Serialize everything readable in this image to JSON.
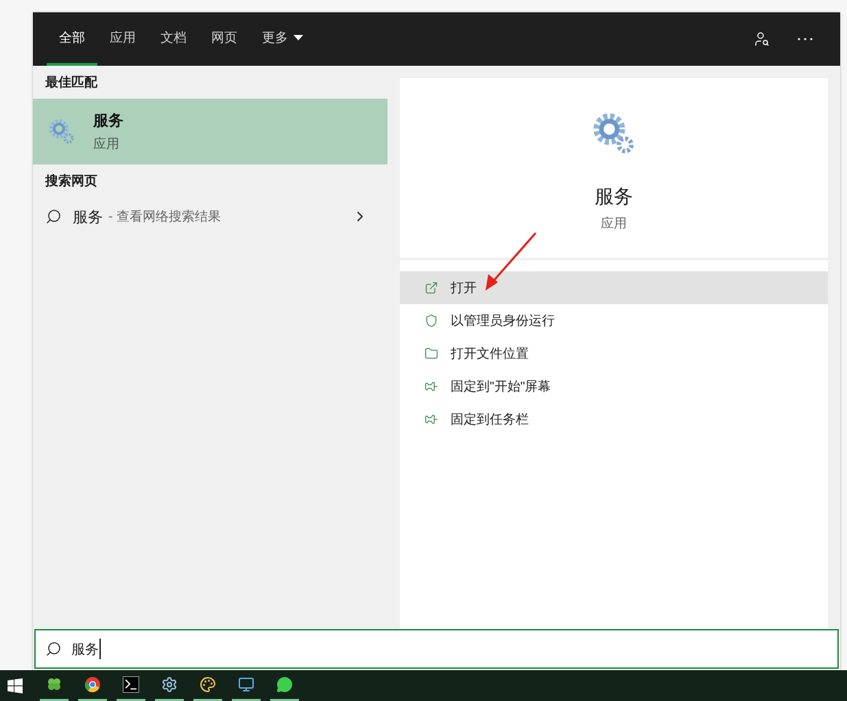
{
  "tabs": [
    {
      "label": "全部",
      "selected": true
    },
    {
      "label": "应用",
      "selected": false
    },
    {
      "label": "文档",
      "selected": false
    },
    {
      "label": "网页",
      "selected": false
    },
    {
      "label": "更多",
      "selected": false,
      "dropdown": true
    }
  ],
  "best_match": {
    "heading": "最佳匹配",
    "title": "服务",
    "subtitle": "应用",
    "selected": true
  },
  "web_search": {
    "heading": "搜索网页",
    "query": "服务",
    "suffix": "- 查看网络搜索结果"
  },
  "detail": {
    "title": "服务",
    "subtitle": "应用"
  },
  "actions": [
    {
      "kind": "open",
      "label": "打开",
      "highlighted": true
    },
    {
      "kind": "admin",
      "label": "以管理员身份运行",
      "highlighted": false
    },
    {
      "kind": "folder",
      "label": "打开文件位置",
      "highlighted": false
    },
    {
      "kind": "pin",
      "label": "固定到\"开始\"屏幕",
      "highlighted": false
    },
    {
      "kind": "pin",
      "label": "固定到任务栏",
      "highlighted": false
    }
  ],
  "search_box": {
    "value": "服务"
  },
  "taskbar": [
    {
      "kind": "clover",
      "running": true
    },
    {
      "kind": "browser",
      "running": true
    },
    {
      "kind": "terminal",
      "running": true
    },
    {
      "kind": "gear",
      "running": true
    },
    {
      "kind": "palette",
      "running": true
    },
    {
      "kind": "monitor",
      "running": true
    },
    {
      "kind": "chat",
      "running": true
    }
  ]
}
